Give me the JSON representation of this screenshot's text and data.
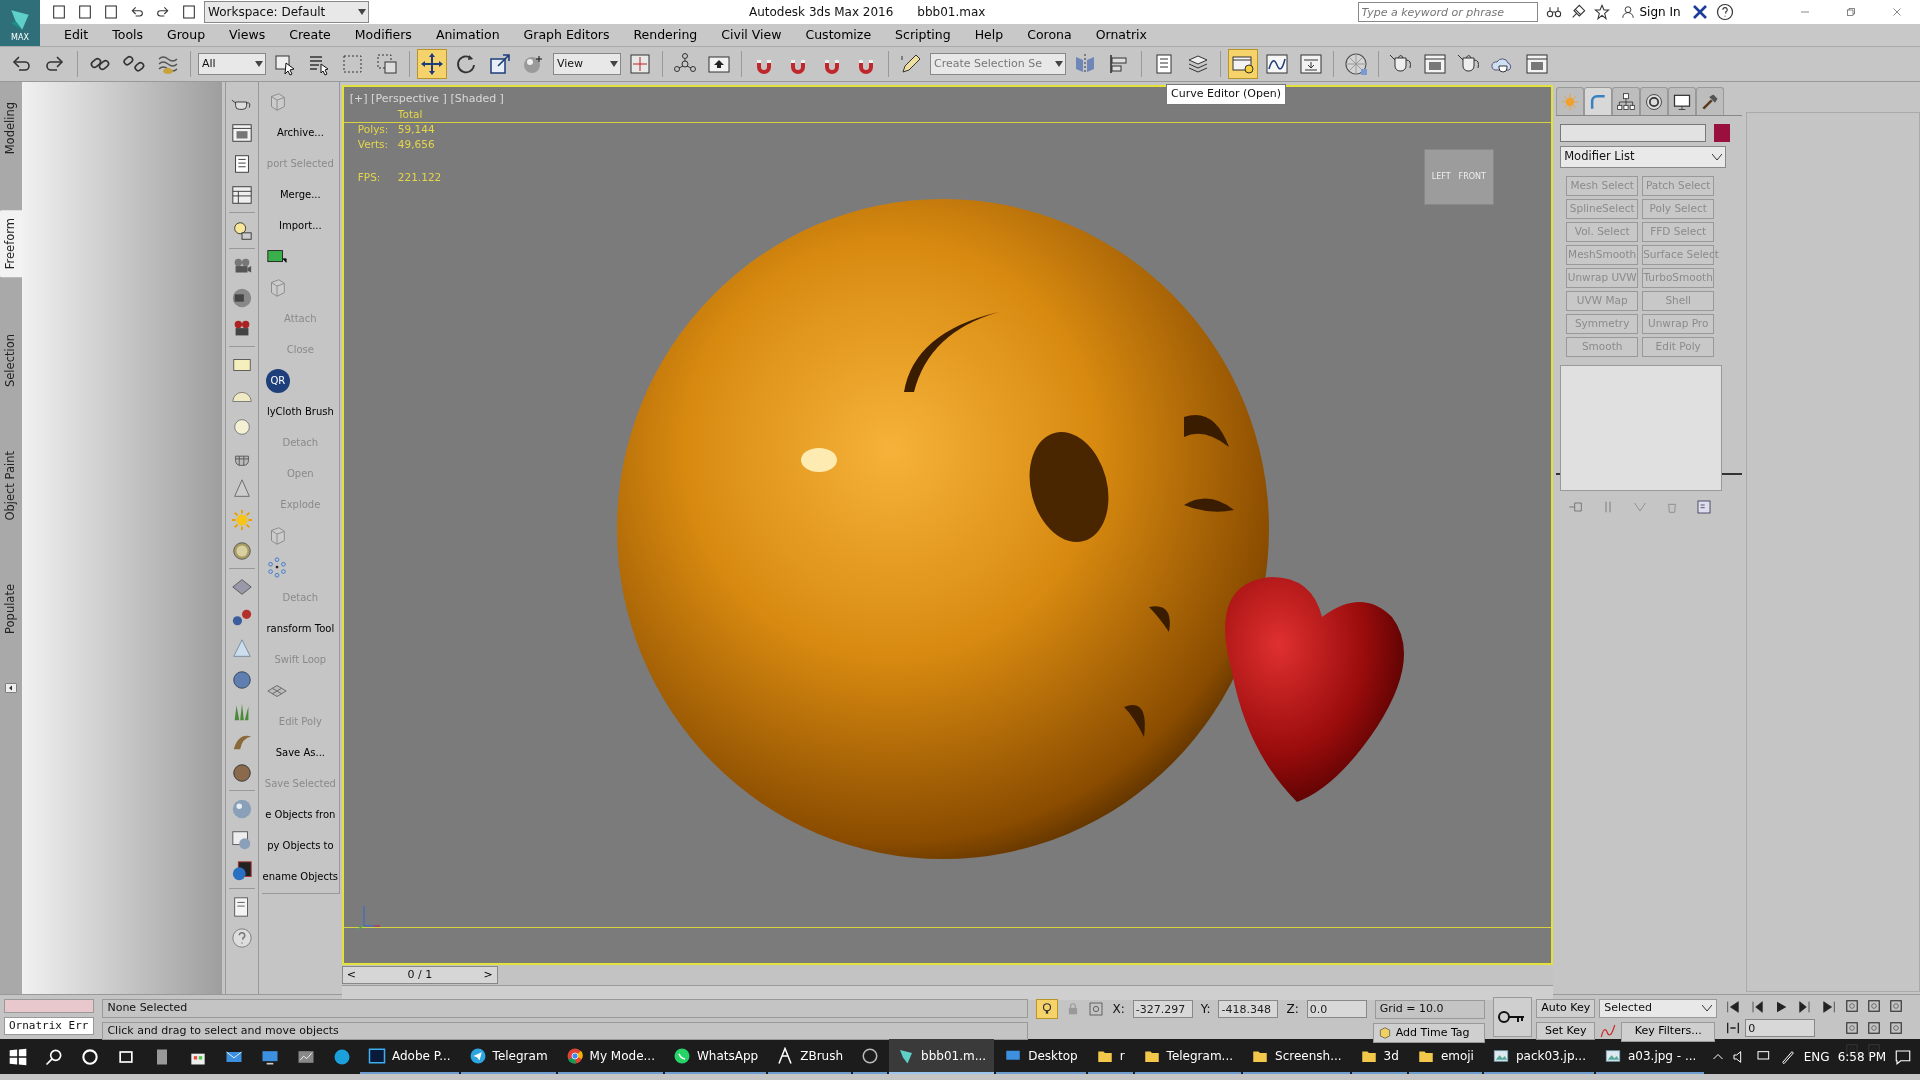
{
  "title_bar": {
    "app_label": "MAX",
    "workspace": "Workspace: Default",
    "app_title": "Autodesk 3ds Max 2016",
    "file_name": "bbb01.max",
    "search": {
      "placeholder": "Type a keyword or phrase"
    },
    "sign_in": "Sign In"
  },
  "menu": [
    "Edit",
    "Tools",
    "Group",
    "Views",
    "Create",
    "Modifiers",
    "Animation",
    "Graph Editors",
    "Rendering",
    "Civil View",
    "Customize",
    "Scripting",
    "Help",
    "Corona",
    "Ornatrix"
  ],
  "main_toolbar": [
    {
      "kind": "undo",
      "selected": false
    },
    {
      "kind": "redo",
      "selected": false
    },
    {
      "kind": "sep"
    },
    {
      "kind": "link",
      "selected": false
    },
    {
      "kind": "unlink",
      "selected": false
    },
    {
      "kind": "bind",
      "selected": false
    },
    {
      "kind": "sep"
    },
    {
      "kind": "dropdown",
      "value": "All"
    },
    {
      "kind": "select",
      "selected": false
    },
    {
      "kind": "selectname",
      "selected": false
    },
    {
      "kind": "region",
      "selected": false
    },
    {
      "kind": "crossing",
      "selected": false
    },
    {
      "kind": "sep"
    },
    {
      "kind": "move",
      "selected": true
    },
    {
      "kind": "rotate",
      "selected": false
    },
    {
      "kind": "scale",
      "selected": false
    },
    {
      "kind": "place",
      "selected": false
    },
    {
      "kind": "dropdown",
      "value": "View"
    },
    {
      "kind": "pivot",
      "selected": false
    },
    {
      "kind": "sep"
    },
    {
      "kind": "manipulate",
      "selected": false
    },
    {
      "kind": "keyboard",
      "selected": false
    },
    {
      "kind": "sep"
    },
    {
      "kind": "snap",
      "selected": false
    },
    {
      "kind": "snap",
      "selected": false
    },
    {
      "kind": "snap",
      "selected": false
    },
    {
      "kind": "snap",
      "selected": false
    },
    {
      "kind": "sep"
    },
    {
      "kind": "pencil",
      "selected": false
    },
    {
      "kind": "combo",
      "placeholder": "Create Selection Se"
    },
    {
      "kind": "mirror",
      "selected": false
    },
    {
      "kind": "align",
      "selected": false
    },
    {
      "kind": "sep"
    },
    {
      "kind": "list",
      "selected": false
    },
    {
      "kind": "layers",
      "selected": false
    },
    {
      "kind": "sep"
    },
    {
      "kind": "ribbon",
      "selected": true
    },
    {
      "kind": "curve",
      "selected": false
    },
    {
      "kind": "schematic",
      "selected": false
    },
    {
      "kind": "sep"
    },
    {
      "kind": "material",
      "selected": false
    },
    {
      "kind": "sep"
    },
    {
      "kind": "teapot",
      "selected": false
    },
    {
      "kind": "window",
      "selected": false
    },
    {
      "kind": "teapot",
      "selected": false
    },
    {
      "kind": "cloud",
      "selected": false
    },
    {
      "kind": "window",
      "selected": false
    }
  ],
  "tooltip": "Curve Editor (Open)",
  "ribbon_tabs": [
    {
      "label": "Modeling",
      "selected": false
    },
    {
      "label": "Freeform",
      "selected": true
    },
    {
      "label": "Selection",
      "selected": false
    },
    {
      "label": "Object Paint",
      "selected": false
    },
    {
      "label": "Populate",
      "selected": false
    }
  ],
  "command_list": [
    {
      "kind": "cube"
    },
    {
      "kind": "text",
      "label": "Archive...",
      "disabled": false
    },
    {
      "kind": "text",
      "label": "port Selected",
      "disabled": true
    },
    {
      "kind": "text",
      "label": "Merge...",
      "disabled": false
    },
    {
      "kind": "text",
      "label": "Import...",
      "disabled": false
    },
    {
      "kind": "screen"
    },
    {
      "kind": "cube"
    },
    {
      "kind": "text",
      "label": "Attach",
      "disabled": true
    },
    {
      "kind": "text",
      "label": "Close",
      "disabled": true
    },
    {
      "kind": "qr",
      "label": "QR"
    },
    {
      "kind": "text",
      "label": "lyCloth Brush",
      "disabled": false
    },
    {
      "kind": "text",
      "label": "Detach",
      "disabled": true
    },
    {
      "kind": "text",
      "label": "Open",
      "disabled": true
    },
    {
      "kind": "text",
      "label": "Explode",
      "disabled": true
    },
    {
      "kind": "cube"
    },
    {
      "kind": "dots"
    },
    {
      "kind": "text",
      "label": "Detach",
      "disabled": true
    },
    {
      "kind": "text",
      "label": "ransform Tool",
      "disabled": false
    },
    {
      "kind": "text",
      "label": "Swift Loop",
      "disabled": true
    },
    {
      "kind": "plane"
    },
    {
      "kind": "text",
      "label": "Edit Poly",
      "disabled": true
    },
    {
      "kind": "text",
      "label": "Save As...",
      "disabled": false
    },
    {
      "kind": "text",
      "label": "Save Selected",
      "disabled": true
    },
    {
      "kind": "text",
      "label": "e Objects fron",
      "disabled": false
    },
    {
      "kind": "text",
      "label": "py Objects to",
      "disabled": false
    },
    {
      "kind": "text",
      "label": "ename Objects",
      "disabled": false
    }
  ],
  "viewport": {
    "label": "[+] [Perspective ] [Shaded ]",
    "stats_header": "Total",
    "stats": [
      {
        "label": "Polys:",
        "value": "59,144"
      },
      {
        "label": "Verts:",
        "value": "49,656"
      },
      {
        "label": "FPS:",
        "value": "221.122"
      }
    ],
    "viewcube": [
      "LEFT",
      "FRONT"
    ]
  },
  "timeline": {
    "prev": "<",
    "frame": "0 / 1",
    "next": ">",
    "level": 0
  },
  "command_panel": {
    "tabs": [
      {
        "kind": "create",
        "selected": false
      },
      {
        "kind": "modify",
        "selected": true
      },
      {
        "kind": "hierarchy",
        "selected": false
      },
      {
        "kind": "motion",
        "selected": false
      },
      {
        "kind": "display",
        "selected": false
      },
      {
        "kind": "utilities",
        "selected": false
      }
    ],
    "modifier_list": "Modifier List",
    "modifier_buttons": [
      "Mesh Select",
      "Patch Select",
      "SplineSelect",
      "Poly Select",
      "Vol. Select",
      "FFD Select",
      "MeshSmooth",
      "Surface Select",
      "Unwrap UVW",
      "TurboSmooth",
      "UVW Map",
      "Shell",
      "Symmetry",
      "Unwrap Pro",
      "Smooth",
      "Edit Poly"
    ]
  },
  "status_bar": {
    "listener_output": "Ornatrix Err",
    "prompt": "None Selected",
    "hint": "Click and drag to select and move objects",
    "coords": [
      {
        "label": "X:",
        "value": "-327.297"
      },
      {
        "label": "Y:",
        "value": "-418.348"
      },
      {
        "label": "Z:",
        "value": "0.0"
      }
    ],
    "grid": "Grid = 10.0",
    "time_tag": "Add Time Tag",
    "auto_key": "Auto Key",
    "set_key": "Set Key",
    "key_mode": "Selected",
    "key_filters": "Key Filters...",
    "frame": "0"
  },
  "taskbar": {
    "items": [
      {
        "kind": "photoshop",
        "label": "Adobe P...",
        "selected": false
      },
      {
        "kind": "telegram",
        "label": "Telegram",
        "selected": false
      },
      {
        "kind": "chrome",
        "label": "My Mode...",
        "selected": false
      },
      {
        "kind": "whatsapp",
        "label": "WhatsApp",
        "selected": false
      },
      {
        "kind": "zbrush",
        "label": "ZBrush",
        "selected": false
      },
      {
        "kind": "obs",
        "selected": false
      },
      {
        "kind": "max",
        "label": "bbb01.m...",
        "selected": true
      },
      {
        "kind": "monitor",
        "label": "Desktop",
        "selected": false
      },
      {
        "kind": "folder",
        "label": "r",
        "selected": false
      },
      {
        "kind": "folder",
        "label": "Telegram...",
        "selected": false
      },
      {
        "kind": "folder",
        "label": "Screensh...",
        "selected": false
      },
      {
        "kind": "folder",
        "label": "3d",
        "selected": false
      },
      {
        "kind": "folder",
        "label": "emoji",
        "selected": false
      },
      {
        "kind": "image",
        "label": "pack03.jp...",
        "selected": false
      },
      {
        "kind": "image",
        "label": "a03.jpg - ...",
        "selected": false
      }
    ],
    "language": "ENG",
    "clock": "6:58 PM"
  }
}
